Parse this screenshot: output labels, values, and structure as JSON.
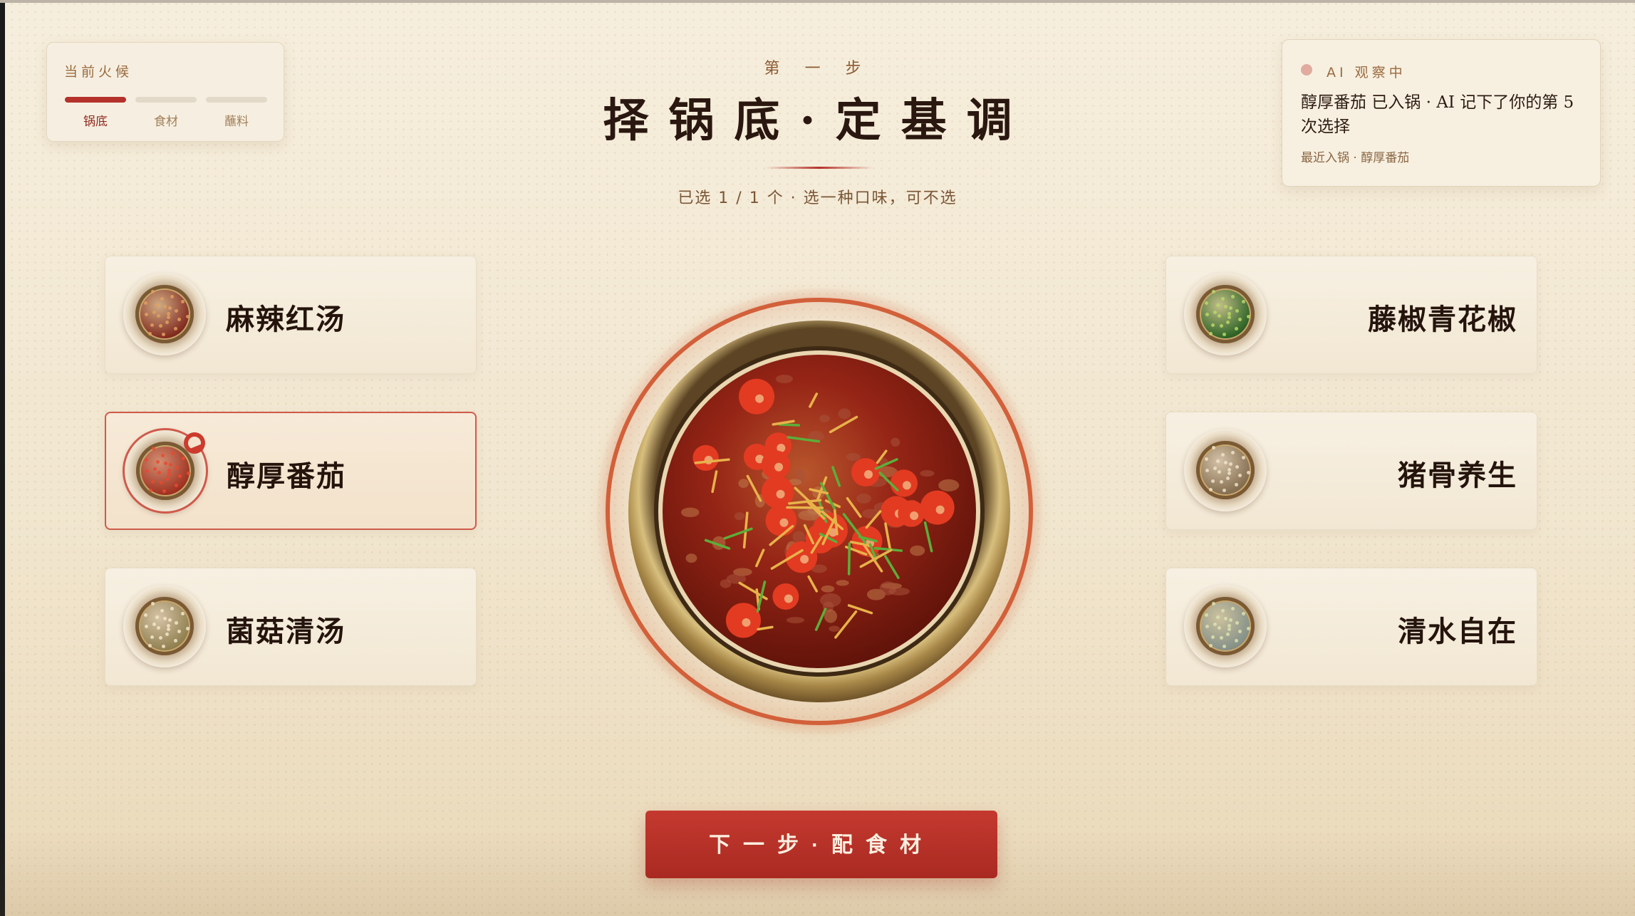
{
  "heat_panel": {
    "title": "当前火候",
    "steps": [
      "锅底",
      "食材",
      "蘸料"
    ],
    "active_index": 0
  },
  "header": {
    "step_label": "第 一 步",
    "title": "择锅底·定基调",
    "subtitle": "已选 1 / 1 个 · 选一种口味，可不选"
  },
  "ai_panel": {
    "status": "AI 观察中",
    "message": "醇厚番茄 已入锅 · AI 记下了你的第 5 次选择",
    "recent": "最近入锅 · 醇厚番茄"
  },
  "bases_left": [
    {
      "label": "麻辣红汤",
      "icon": "spicy-red-soup-icon",
      "soup_color": "#7a1f16",
      "fleck_color": "#e0a060",
      "selected": false
    },
    {
      "label": "醇厚番茄",
      "icon": "tomato-soup-icon",
      "soup_color": "#9a2818",
      "fleck_color": "#e84a2e",
      "selected": true
    },
    {
      "label": "菌菇清汤",
      "icon": "mushroom-soup-icon",
      "soup_color": "#8a7a48",
      "fleck_color": "#f2e6c8",
      "selected": false
    }
  ],
  "bases_right": [
    {
      "label": "藤椒青花椒",
      "icon": "green-pepper-soup-icon",
      "soup_color": "#1f5a1c",
      "fleck_color": "#b8d86a",
      "selected": false
    },
    {
      "label": "猪骨养生",
      "icon": "pork-bone-soup-icon",
      "soup_color": "#7d6648",
      "fleck_color": "#efe2c8",
      "selected": false
    },
    {
      "label": "清水自在",
      "icon": "clear-water-soup-icon",
      "soup_color": "#7e8c86",
      "fleck_color": "#d9e2b0",
      "selected": false
    }
  ],
  "pot": {
    "icon": "hotpot-icon",
    "broth_color": "#8f1f14",
    "tomato_color": "#e23b22",
    "herb_color": "#5cae3a",
    "ginger_color": "#e8b24a"
  },
  "next_button": {
    "label": "下一步·配食材"
  },
  "colors": {
    "accent": "#b5312b",
    "background": "#f3e9d5",
    "ring": "#d2603a"
  }
}
